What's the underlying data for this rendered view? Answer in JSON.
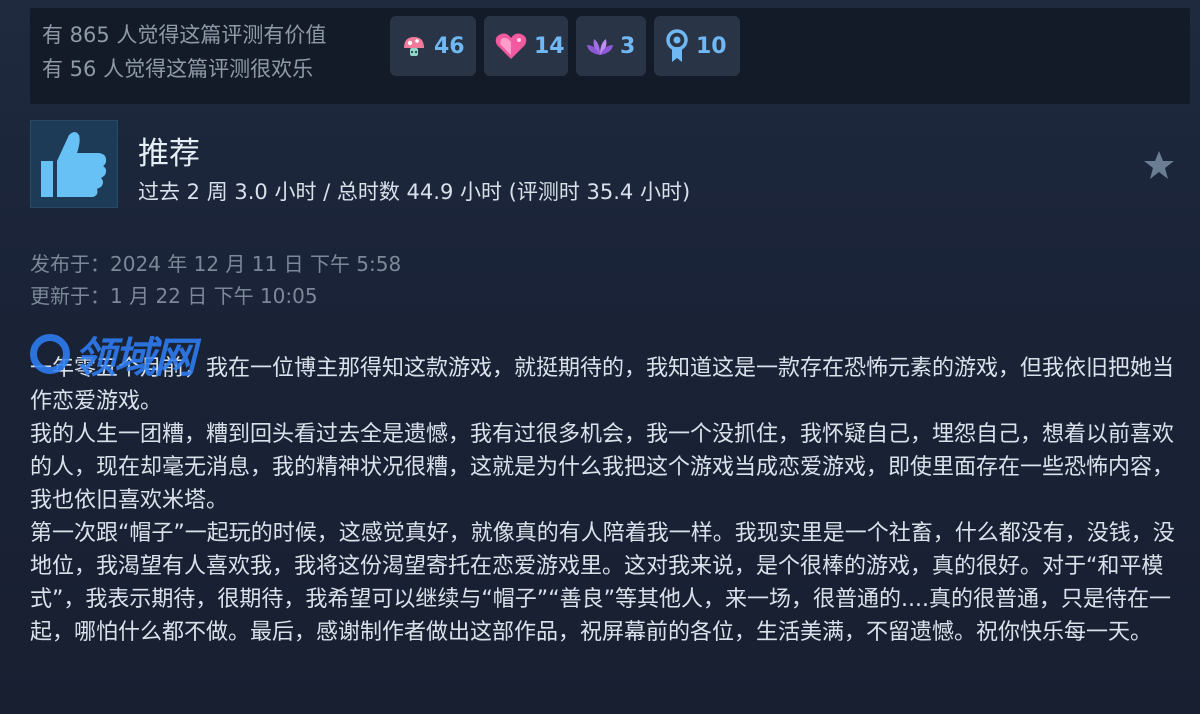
{
  "helpful": {
    "valuable": "有 865 人觉得这篇评测有价值",
    "funny": "有 56 人觉得这篇评测很欢乐"
  },
  "awards": [
    {
      "icon": "mushroom-award-icon",
      "count": "46"
    },
    {
      "icon": "heart-gem-award-icon",
      "count": "14"
    },
    {
      "icon": "lotus-award-icon",
      "count": "3"
    },
    {
      "icon": "ribbon-medal-award-icon",
      "count": "10"
    }
  ],
  "review": {
    "verdict": "推荐",
    "hours": "过去 2 周 3.0 小时 / 总时数 44.9 小时   (评测时 35.4 小时)",
    "posted": "发布于：2024 年 12 月 11 日 下午 5:58",
    "updated": "更新于：1 月 22 日 下午 10:05",
    "paragraphs": [
      "一年零五个月前，我在一位博主那得知这款游戏，就挺期待的，我知道这是一款存在恐怖元素的游戏，但我依旧把她当作恋爱游戏。",
      "我的人生一团糟，糟到回头看过去全是遗憾，我有过很多机会，我一个没抓住，我怀疑自己，埋怨自己，想着以前喜欢的人，现在却毫无消息，我的精神状况很糟，这就是为什么我把这个游戏当成恋爱游戏，即使里面存在一些恐怖内容，我也依旧喜欢米塔。",
      "第一次跟“帽子”一起玩的时候，这感觉真好，就像真的有人陪着我一样。我现实里是一个社畜，什么都没有，没钱，没地位，我渴望有人喜欢我，我将这份渴望寄托在恋爱游戏里。这对我来说，是个很棒的游戏，真的很好。对于“和平模式”，我表示期待，很期待，我希望可以继续与“帽子”“善良”等其他人，来一场，很普通的....真的很普通，只是待在一起，哪怕什么都不做。最后，感谢制作者做出这部作品，祝屏幕前的各位，生活美满，不留遗憾。祝你快乐每一天。"
    ]
  },
  "watermark": "领域网",
  "colors": {
    "background": "#1a2235",
    "award_count": "#6fb8f4",
    "thumb_icon": "#67c1f5",
    "watermark": "#2e7ef5"
  }
}
